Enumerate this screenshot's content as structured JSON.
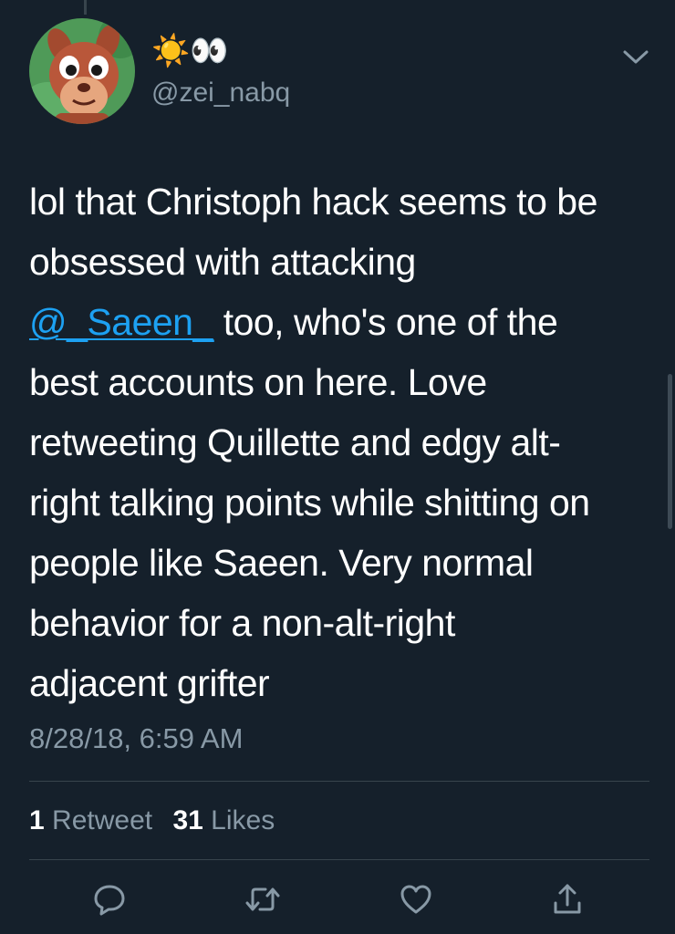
{
  "tweet": {
    "display_name_emoji": "☀️👀",
    "handle": "@zei_nabq",
    "text_lines": [
      "lol that Christoph hack seems to be",
      "obsessed with attacking",
      "too, who's one of the",
      "best accounts on here. Love",
      "retweeting Quillette and edgy alt-",
      "right talking points while shitting on",
      "people like Saeen. Very normal",
      "behavior for a non-alt-right",
      "adjacent grifter"
    ],
    "mention": "@_Saeen_",
    "timestamp": "8/28/18, 6:59 AM"
  },
  "stats": {
    "retweets_count": "1",
    "retweets_label": "Retweet",
    "likes_count": "31",
    "likes_label": "Likes"
  },
  "icons": {
    "menu": "chevron-down-icon",
    "reply": "reply-icon",
    "retweet": "retweet-icon",
    "like": "heart-icon",
    "share": "share-icon"
  },
  "colors": {
    "background": "#15202b",
    "accent": "#1da1f2",
    "secondary_text": "#8899a6",
    "divider": "#38444d"
  }
}
